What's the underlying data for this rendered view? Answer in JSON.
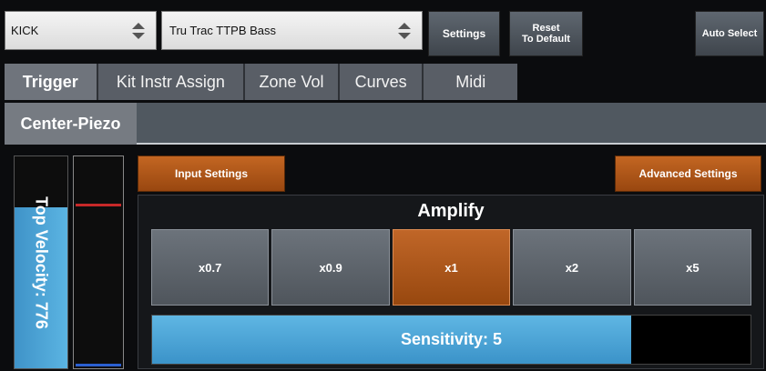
{
  "top_bar": {
    "instrument_select": {
      "value": "KICK"
    },
    "kit_select": {
      "value": "Tru Trac TTPB Bass"
    },
    "settings_button": "Settings",
    "reset_button": {
      "line1": "Reset",
      "line2": "To Default"
    },
    "auto_select_button": "Auto Select"
  },
  "tabs": [
    {
      "label": "Trigger",
      "active": true
    },
    {
      "label": "Kit Instr Assign",
      "active": false
    },
    {
      "label": "Zone Vol",
      "active": false
    },
    {
      "label": "Curves",
      "active": false
    },
    {
      "label": "Midi",
      "active": false
    }
  ],
  "zone_tab": "Center-Piezo",
  "left_meter": {
    "label": "Top Velocity: 776",
    "velocity_value": 776,
    "velocity_fill_fraction": 0.76
  },
  "input_settings_button": "Input Settings",
  "advanced_settings_button": "Advanced Settings",
  "amplify": {
    "title": "Amplify",
    "options": [
      "x0.7",
      "x0.9",
      "x1",
      "x2",
      "x5"
    ],
    "selected": "x1"
  },
  "sensitivity": {
    "label": "Sensitivity: 5",
    "value": 5,
    "fill_fraction": 0.8
  },
  "colors": {
    "accent_orange": "#b0561a",
    "accent_blue": "#4aa3d6",
    "peak_red": "#c62828"
  }
}
